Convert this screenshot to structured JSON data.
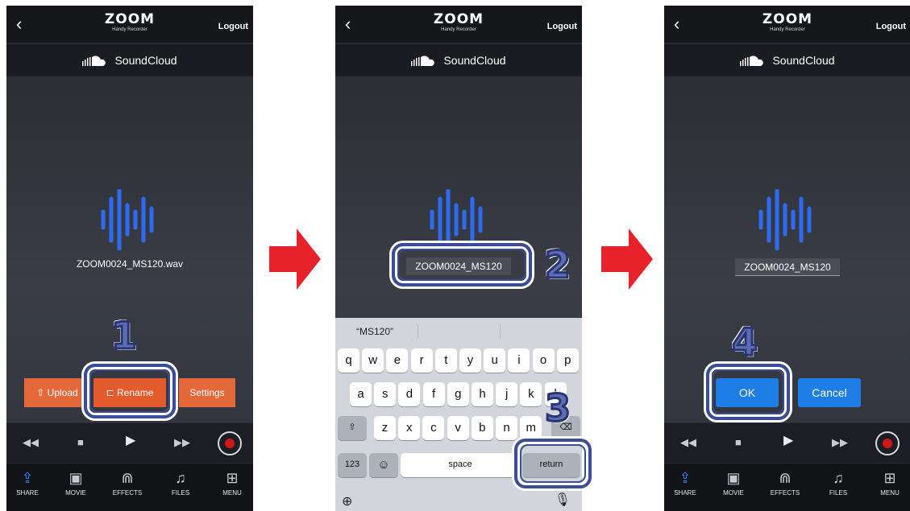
{
  "header": {
    "logo_text": "ZOOM",
    "logo_sub": "Handy Recorder",
    "logout_label": "Logout"
  },
  "service": {
    "name": "SoundCloud"
  },
  "screen1": {
    "filename": "ZOOM0024_MS120.wav",
    "upload_label": "Upload",
    "rename_label": "Rename",
    "settings_label": "Settings",
    "step": "1"
  },
  "screen2": {
    "name_value": "ZOOM0024_MS120",
    "step_name": "2",
    "step_return": "3",
    "keyboard": {
      "suggestion": "“MS120”",
      "row1": [
        "q",
        "w",
        "e",
        "r",
        "t",
        "y",
        "u",
        "i",
        "o",
        "p"
      ],
      "row2": [
        "a",
        "s",
        "d",
        "f",
        "g",
        "h",
        "j",
        "k",
        "l"
      ],
      "row3": [
        "z",
        "x",
        "c",
        "v",
        "b",
        "n",
        "m"
      ],
      "numbers_label": "123",
      "space_label": "space",
      "return_label": "return"
    }
  },
  "screen3": {
    "name_value": "ZOOM0024_MS120",
    "ok_label": "OK",
    "cancel_label": "Cancel",
    "step": "4"
  },
  "tabs": [
    {
      "label": "SHARE",
      "icon": "share-icon"
    },
    {
      "label": "MOVIE",
      "icon": "movie-icon"
    },
    {
      "label": "EFFECTS",
      "icon": "effects-icon"
    },
    {
      "label": "FILES",
      "icon": "files-icon"
    },
    {
      "label": "MENU",
      "icon": "menu-icon"
    }
  ],
  "colors": {
    "orange": "#e5683a",
    "blue": "#1f7de6",
    "highlight": "#3a4d96",
    "arrow": "#e8222a",
    "wave": "#2d6cf0"
  }
}
